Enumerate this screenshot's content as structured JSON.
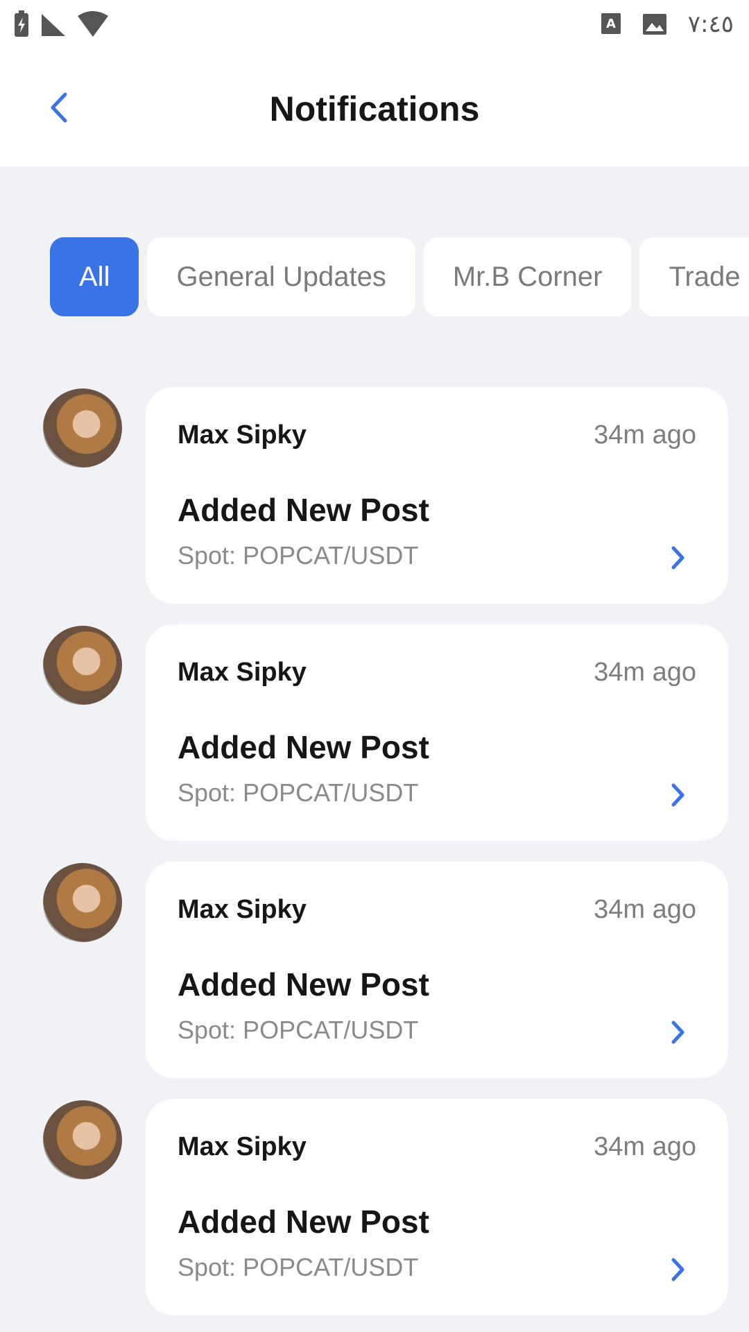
{
  "status_bar": {
    "time": "٧:٤٥",
    "icons": [
      "battery-charging-icon",
      "signal-icon",
      "wifi-icon",
      "keyboard-icon",
      "image-icon"
    ]
  },
  "header": {
    "title": "Notifications",
    "back_icon": "chevron-left-icon"
  },
  "tabs": [
    {
      "label": "All",
      "active": true
    },
    {
      "label": "General Updates",
      "active": false
    },
    {
      "label": "Mr.B Corner",
      "active": false
    },
    {
      "label": "Trade",
      "active": false
    }
  ],
  "notifications": [
    {
      "name": "Max Sipky",
      "time": "34m ago",
      "title": "Added New Post",
      "subtitle": "Spot: POPCAT/USDT"
    },
    {
      "name": "Max Sipky",
      "time": "34m ago",
      "title": "Added New Post",
      "subtitle": "Spot: POPCAT/USDT"
    },
    {
      "name": "Max Sipky",
      "time": "34m ago",
      "title": "Added New Post",
      "subtitle": "Spot: POPCAT/USDT"
    },
    {
      "name": "Max Sipky",
      "time": "34m ago",
      "title": "Added New Post",
      "subtitle": "Spot: POPCAT/USDT"
    }
  ],
  "colors": {
    "accent": "#3a72e8",
    "background": "#f0f2f5",
    "card": "#ffffff"
  }
}
